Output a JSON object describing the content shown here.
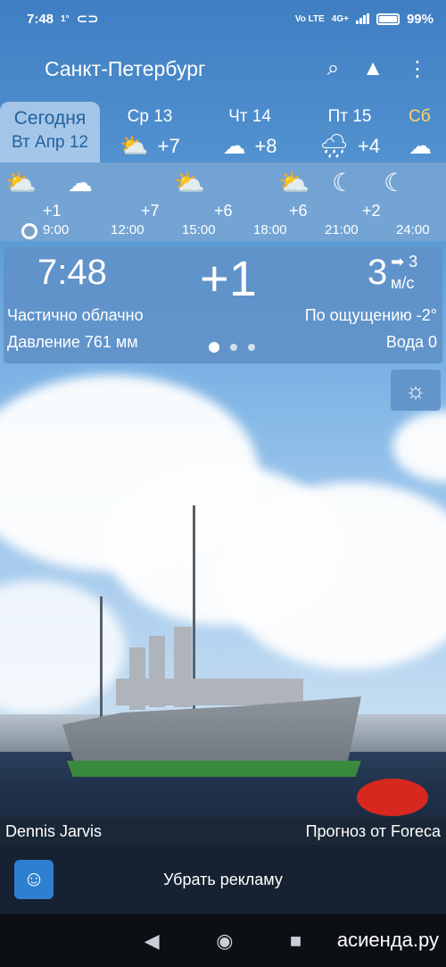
{
  "status_bar": {
    "time": "7:48",
    "temp_indicator": "1°",
    "battery_percent": "99%",
    "network": "4G+",
    "volte": "Vo LTE"
  },
  "app_bar": {
    "city": "Санкт-Петербург",
    "icons": [
      "search-icon",
      "landscape-icon",
      "more-icon"
    ]
  },
  "days": {
    "today": {
      "label": "Сегодня",
      "date": "Вт Апр 12"
    },
    "forecast": [
      {
        "label": "Ср 13",
        "icon": "sun-cloud-icon",
        "temp": "+7"
      },
      {
        "label": "Чт 14",
        "icon": "cloud-icon",
        "temp": "+8"
      },
      {
        "label": "Пт 15",
        "icon": "rain-cloud-icon",
        "temp": "+4"
      },
      {
        "label": "Сб",
        "icon": "cloud-icon",
        "temp": ""
      }
    ]
  },
  "hourly": {
    "temps": [
      "+1",
      "+7",
      "+6",
      "+6",
      "+2"
    ],
    "times": [
      "9:00",
      "12:00",
      "15:00",
      "18:00",
      "21:00",
      "24:00"
    ]
  },
  "current": {
    "time": "7:48",
    "temp": "+1",
    "wind_speed": "3",
    "wind_gust": "3",
    "wind_unit": "м/с",
    "condition": "Частично облачно",
    "feels_like": "По ощущению -2°",
    "pressure": "Давление 761 мм",
    "water": "Вода 0"
  },
  "credits": {
    "photo_author": "Dennis Jarvis",
    "forecast_source": "Прогноз от Foreca"
  },
  "ad": {
    "label": "Убрать рекламу"
  },
  "watermark": "асиенда.ру",
  "colors": {
    "today_tab": "#a9c9ea",
    "today_text": "#1f5f9c",
    "card_bg": "#5f91c8",
    "weekend": "#ffd36a"
  }
}
